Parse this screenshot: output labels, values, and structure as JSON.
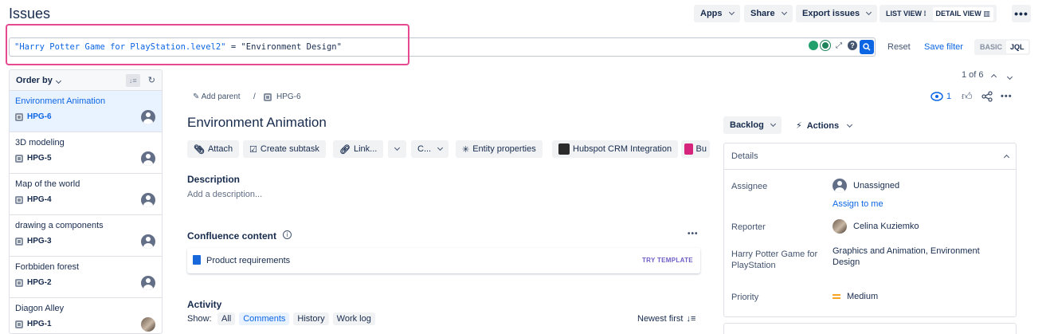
{
  "header": {
    "title": "Issues",
    "apps_label": "Apps",
    "share_label": "Share",
    "export_label": "Export issues",
    "list_view_label": "LIST VIEW",
    "detail_view_label": "DETAIL VIEW"
  },
  "search": {
    "jql_field": "\"Harry Potter Game for PlayStation.level2\"",
    "jql_rest": " = \"Environment Design\"",
    "reset_label": "Reset",
    "save_filter_label": "Save filter",
    "basic_label": "BASIC",
    "jql_label": "JQL"
  },
  "list": {
    "order_by_label": "Order by",
    "items": [
      {
        "title": "Environment Animation",
        "key": "HPG-6"
      },
      {
        "title": "3D modeling",
        "key": "HPG-5"
      },
      {
        "title": "Map of the world",
        "key": "HPG-4"
      },
      {
        "title": "drawing a components",
        "key": "HPG-3"
      },
      {
        "title": "Forbbiden forest",
        "key": "HPG-2"
      },
      {
        "title": "Diagon Alley",
        "key": "HPG-1"
      }
    ]
  },
  "issue": {
    "add_parent_label": "Add parent",
    "key": "HPG-6",
    "pager": "1 of 6",
    "watchers": "1",
    "title": "Environment Animation",
    "toolbar": {
      "attach": "Attach",
      "create_subtask": "Create subtask",
      "link": "Link...",
      "c": "C...",
      "entity_properties": "Entity properties",
      "hubspot": "Hubspot CRM Integration",
      "bu": "Bu"
    },
    "description_label": "Description",
    "description_placeholder": "Add a description...",
    "confluence_label": "Confluence content",
    "confluence_item": "Product requirements",
    "try_template": "TRY TEMPLATE",
    "activity_label": "Activity",
    "show_label": "Show:",
    "tabs": [
      "All",
      "Comments",
      "History",
      "Work log"
    ],
    "newest_first": "Newest first"
  },
  "side": {
    "status_label": "Backlog",
    "actions_label": "Actions",
    "details_label": "Details",
    "assignee_label": "Assignee",
    "assignee_value": "Unassigned",
    "assign_to_me": "Assign to me",
    "reporter_label": "Reporter",
    "reporter_value": "Celina Kuziemko",
    "custom_label": "Harry Potter Game for PlayStation",
    "custom_value": "Graphics and Animation, Environment Design",
    "priority_label": "Priority",
    "priority_value": "Medium"
  },
  "colors": {
    "accent": "#0c66e4",
    "highlight": "#e6498f",
    "priority": "#f5a623"
  }
}
